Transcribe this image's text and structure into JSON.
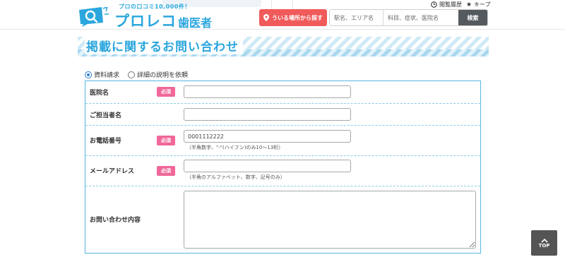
{
  "header": {
    "logo": {
      "tagline": "プロの口コミ10,000件！",
      "text": "プロレコ",
      "sub": "歯医者"
    },
    "locate_button": "ういる場所から探す",
    "search": {
      "area_placeholder": "駅名、エリア名",
      "term_placeholder": "科目、症状、医院名",
      "button": "検索"
    },
    "history_label": "閲覧履歴",
    "keep_label": "キープ"
  },
  "page_title": "掲載に関するお問い合わせ",
  "inquiry_type": {
    "options": [
      "資料請求",
      "詳細の説明を依頼"
    ],
    "selected": "資料請求"
  },
  "form": {
    "required_badge": "必須",
    "rows": [
      {
        "label": "医院名",
        "required": true,
        "value": ""
      },
      {
        "label": "ご担当者名",
        "required": false,
        "value": ""
      },
      {
        "label": "お電話番号",
        "required": true,
        "value": "0001112222",
        "hint": "（半角数字、\"-\"(ハイフン)のみ10～13桁）"
      },
      {
        "label": "メールアドレス",
        "required": true,
        "value": "",
        "hint": "（半角のアルファベット、数字、記号のみ）"
      },
      {
        "label": "お問い合わせ内容",
        "required": false,
        "value": ""
      }
    ]
  },
  "top_button": "TOP",
  "colors": {
    "accent": "#2ba6de",
    "required": "#f0679a",
    "locate": "#f05a5a"
  }
}
